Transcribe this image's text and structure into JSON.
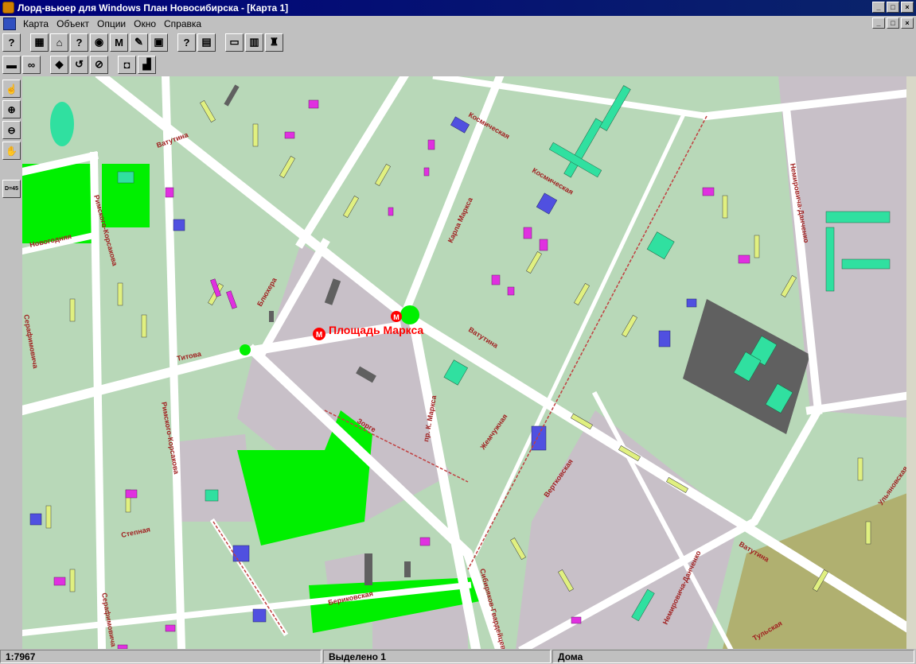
{
  "window": {
    "title": "Лорд-вьюер для Windows План Новосибирска - [Карта 1]",
    "controls": [
      "_",
      "□",
      "×"
    ]
  },
  "menu": {
    "items": [
      "Карта",
      "Объект",
      "Опции",
      "Окно",
      "Справка"
    ]
  },
  "toolbar1": [
    {
      "name": "help-icon",
      "glyph": "?"
    },
    {
      "name": "map-select-icon",
      "glyph": "▦"
    },
    {
      "name": "house-icon",
      "glyph": "⌂"
    },
    {
      "name": "question-book-icon",
      "glyph": "?"
    },
    {
      "name": "camera-icon",
      "glyph": "◉"
    },
    {
      "name": "metro-icon",
      "glyph": "M"
    },
    {
      "name": "pen-icon",
      "glyph": "✎"
    },
    {
      "name": "frame-icon",
      "glyph": "▣"
    },
    {
      "name": "context-help-icon",
      "glyph": "?"
    },
    {
      "name": "book-icon",
      "glyph": "▤"
    },
    {
      "name": "computer-icon",
      "glyph": "▭"
    },
    {
      "name": "open-book-icon",
      "glyph": "▥"
    },
    {
      "name": "chair-icon",
      "glyph": "♜"
    }
  ],
  "toolbar2": [
    {
      "name": "print-icon",
      "glyph": "▬"
    },
    {
      "name": "binoculars-icon",
      "glyph": "∞"
    },
    {
      "name": "layers-icon",
      "glyph": "◆"
    },
    {
      "name": "undo-icon",
      "glyph": "↺"
    },
    {
      "name": "no-ruler-icon",
      "glyph": "⊘"
    },
    {
      "name": "object-icon",
      "glyph": "◘"
    },
    {
      "name": "chart-icon",
      "glyph": "▟"
    }
  ],
  "sidetools": [
    {
      "name": "select-hand-icon",
      "glyph": "☝"
    },
    {
      "name": "zoom-in-icon",
      "glyph": "⊕"
    },
    {
      "name": "zoom-out-icon",
      "glyph": "⊖"
    },
    {
      "name": "pan-hand-icon",
      "glyph": "✋"
    },
    {
      "name": "rotate-45-icon",
      "glyph": "D=45"
    }
  ],
  "map": {
    "metro_label": "Площадь Маркса",
    "streets": {
      "vatutina": "Ватутина",
      "titova": "Титова",
      "blukhera": "Блюхера",
      "karla_marksa": "Карла Маркса",
      "pr_k_marksa": "пр. К. Маркса",
      "rimskogo": "Римского-Корсакова",
      "serafimovicha": "Серафимовича",
      "nemirovicha": "Немировича-Данченко",
      "kosmicheskaya": "Космическая",
      "berezovskaya": "Бериковская",
      "novogodnyaya": "Новогодняя",
      "zorge": "Зорге",
      "stepnaya": "Степная",
      "sibiryakov": "Сибиряков-Гвардейцев",
      "zhemchuzhnaya": "Жемчужная",
      "ulyanovskaya": "Ульяновская",
      "tulskaya": "Тульская",
      "vertkovskaya": "Вертковская",
      "nikolaya": "Римского-Корсакова"
    },
    "colors": {
      "land": "#b8d8b8",
      "road": "#ffffff",
      "park": "#00f000",
      "building_yellow": "#e0f080",
      "building_teal": "#30e0a0",
      "building_magenta": "#e030e0",
      "building_blue": "#5050e0",
      "plaza": "#c8c0c8",
      "industrial": "#606060",
      "metro": "#ff0000"
    }
  },
  "status": {
    "scale": "1:7967",
    "selected": "Выделено 1",
    "layer": "Дома"
  }
}
